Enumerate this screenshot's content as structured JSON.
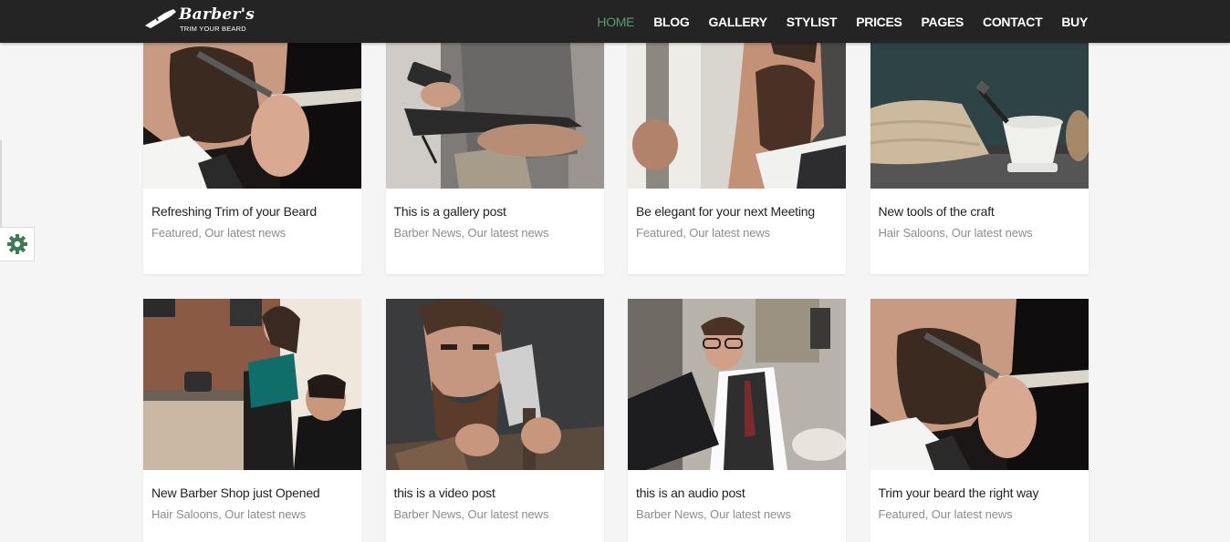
{
  "brand": {
    "name": "Barber's",
    "tagline": "TRIM YOUR BEARD"
  },
  "nav": [
    {
      "label": "HOME",
      "active": true
    },
    {
      "label": "BLOG"
    },
    {
      "label": "GALLERY"
    },
    {
      "label": "STYLIST"
    },
    {
      "label": "PRICES"
    },
    {
      "label": "PAGES"
    },
    {
      "label": "CONTACT"
    },
    {
      "label": "BUY"
    }
  ],
  "side_widget": {
    "icon": "gear-icon",
    "color": "#3e7a55"
  },
  "posts": [
    {
      "title": "Refreshing Trim of your Beard",
      "cats": "Featured, Our latest news",
      "image": "bearded-man-razor-shave"
    },
    {
      "title": "This is a gallery post",
      "cats": "Barber News, Our latest news",
      "image": "man-phone-notebook"
    },
    {
      "title": "Be elegant for your next Meeting",
      "cats": "Featured, Our latest news",
      "image": "bearded-man-window-profile"
    },
    {
      "title": "New tools of the craft",
      "cats": "Hair Saloons, Our latest news",
      "image": "shaving-bowl-towel"
    },
    {
      "title": "New Barber Shop just Opened",
      "cats": "Hair Saloons, Our latest news",
      "image": "barber-woman-cutting-hair"
    },
    {
      "title": "this is a video post",
      "cats": "Barber News, Our latest news",
      "image": "bearded-man-axe"
    },
    {
      "title": "this is an audio post",
      "cats": "Barber News, Our latest news",
      "image": "man-glasses-laptop"
    },
    {
      "title": "Trim your beard the right way",
      "cats": "Featured, Our latest news",
      "image": "bearded-man-razor-shave"
    }
  ],
  "colors": {
    "header_bg": "#242424",
    "accent": "#5c9a72",
    "page_bg": "#f5f5f5"
  }
}
